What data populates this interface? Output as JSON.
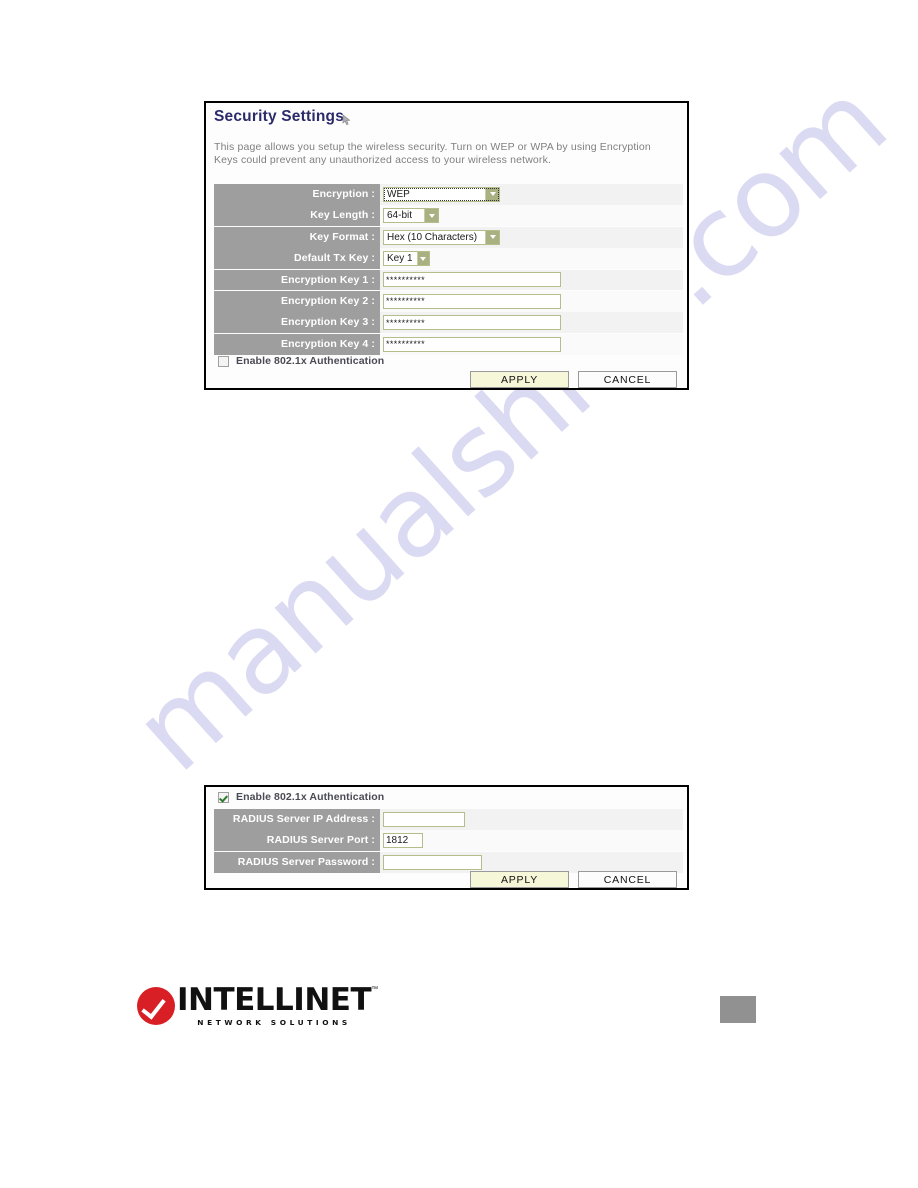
{
  "watermark": {
    "text": "manualshive.com",
    "color": "#d9d9f2"
  },
  "security_panel": {
    "title": "Security Settings",
    "title_icon": "help-pointer-icon",
    "description": "This page allows you setup the wireless security. Turn on WEP or WPA by using Encryption Keys could prevent any unauthorized access to your wireless network.",
    "rows": [
      {
        "label": "Encryption :",
        "type": "select",
        "value": "WEP",
        "focused": true
      },
      {
        "label": "Key Length :",
        "type": "select",
        "value": "64-bit",
        "focused": false
      },
      {
        "label": "Key Format :",
        "type": "select",
        "value": "Hex (10 Characters)",
        "focused": false
      },
      {
        "label": "Default Tx Key :",
        "type": "select",
        "value": "Key 1",
        "focused": false
      },
      {
        "label": "Encryption Key 1 :",
        "type": "text",
        "value": "**********"
      },
      {
        "label": "Encryption Key 2 :",
        "type": "text",
        "value": "**********"
      },
      {
        "label": "Encryption Key 3 :",
        "type": "text",
        "value": "**********"
      },
      {
        "label": "Encryption Key 4 :",
        "type": "text",
        "value": "**********"
      }
    ],
    "checkbox": {
      "label": "Enable 802.1x Authentication",
      "checked": false
    },
    "buttons": {
      "apply": "APPLY",
      "cancel": "CANCEL"
    }
  },
  "radius_panel": {
    "checkbox": {
      "label": "Enable 802.1x Authentication",
      "checked": true
    },
    "rows": [
      {
        "label": "RADIUS Server IP Address :",
        "type": "text",
        "value": ""
      },
      {
        "label": "RADIUS Server Port :",
        "type": "text",
        "value": "1812"
      },
      {
        "label": "RADIUS Server Password :",
        "type": "text",
        "value": ""
      }
    ],
    "buttons": {
      "apply": "APPLY",
      "cancel": "CANCEL"
    }
  },
  "footer": {
    "logo_word": "INTELLINET",
    "logo_tm": "™",
    "logo_sub": "NETWORK SOLUTIONS",
    "page_number": ""
  },
  "colors": {
    "label_gray": "#9e9e9e",
    "field_border": "#b5bd8a",
    "dropdown_arrow": "#a9b183",
    "apply_bg": "#f6f6d8",
    "title_blue": "#2b2b6b",
    "logo_red": "#d81f26"
  }
}
